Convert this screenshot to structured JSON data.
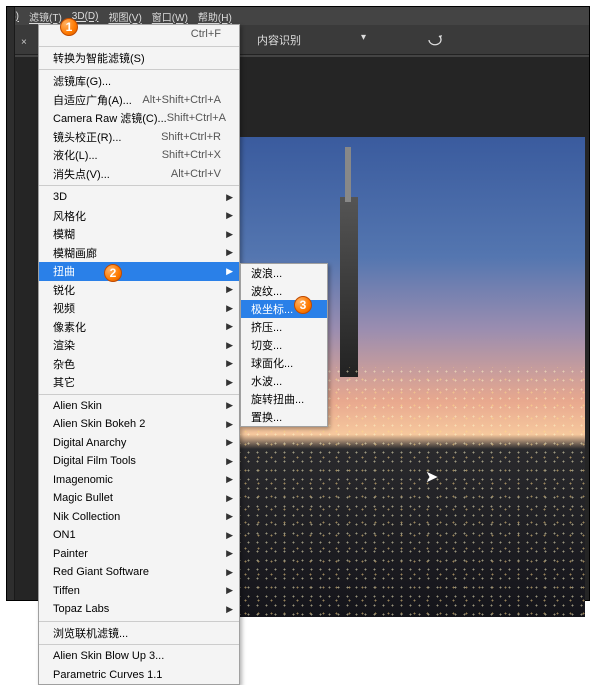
{
  "menubar": {
    "items": [
      "S)",
      "滤镜(T)",
      "3D(D)",
      "视图(V)",
      "窗口(W)",
      "帮助(H)"
    ]
  },
  "optionsbar": {
    "label": "内容识别",
    "undo_icon": "undo"
  },
  "badges": {
    "b1": "1",
    "b2": "2",
    "b3": "3"
  },
  "filter_menu": {
    "last": {
      "label": "",
      "shortcut": "Ctrl+F"
    },
    "convert": "转换为智能滤镜(S)",
    "sec1": [
      {
        "label": "滤镜库(G)...",
        "shortcut": ""
      },
      {
        "label": "自适应广角(A)...",
        "shortcut": "Alt+Shift+Ctrl+A"
      },
      {
        "label": "Camera Raw 滤镜(C)...",
        "shortcut": "Shift+Ctrl+A"
      },
      {
        "label": "镜头校正(R)...",
        "shortcut": "Shift+Ctrl+R"
      },
      {
        "label": "液化(L)...",
        "shortcut": "Shift+Ctrl+X"
      },
      {
        "label": "消失点(V)...",
        "shortcut": "Alt+Ctrl+V"
      }
    ],
    "sec2": [
      "3D",
      "风格化",
      "模糊",
      "模糊画廊",
      "扭曲",
      "锐化",
      "视频",
      "像素化",
      "渲染",
      "杂色",
      "其它"
    ],
    "sec3": [
      "Alien Skin",
      "Alien Skin Bokeh 2",
      "Digital Anarchy",
      "Digital Film Tools",
      "Imagenomic",
      "Magic Bullet",
      "Nik Collection",
      "ON1",
      "Painter",
      "Red Giant Software",
      "Tiffen",
      "Topaz Labs"
    ],
    "browse": "浏览联机滤镜...",
    "sec4": [
      "Alien Skin Blow Up 3...",
      "Parametric Curves 1.1"
    ],
    "highlight": "扭曲"
  },
  "distort_submenu": {
    "items": [
      "波浪...",
      "波纹...",
      "极坐标...",
      "挤压...",
      "切变...",
      "球面化...",
      "水波...",
      "旋转扭曲...",
      "置换..."
    ],
    "highlight": "极坐标..."
  },
  "tab_label": "×"
}
